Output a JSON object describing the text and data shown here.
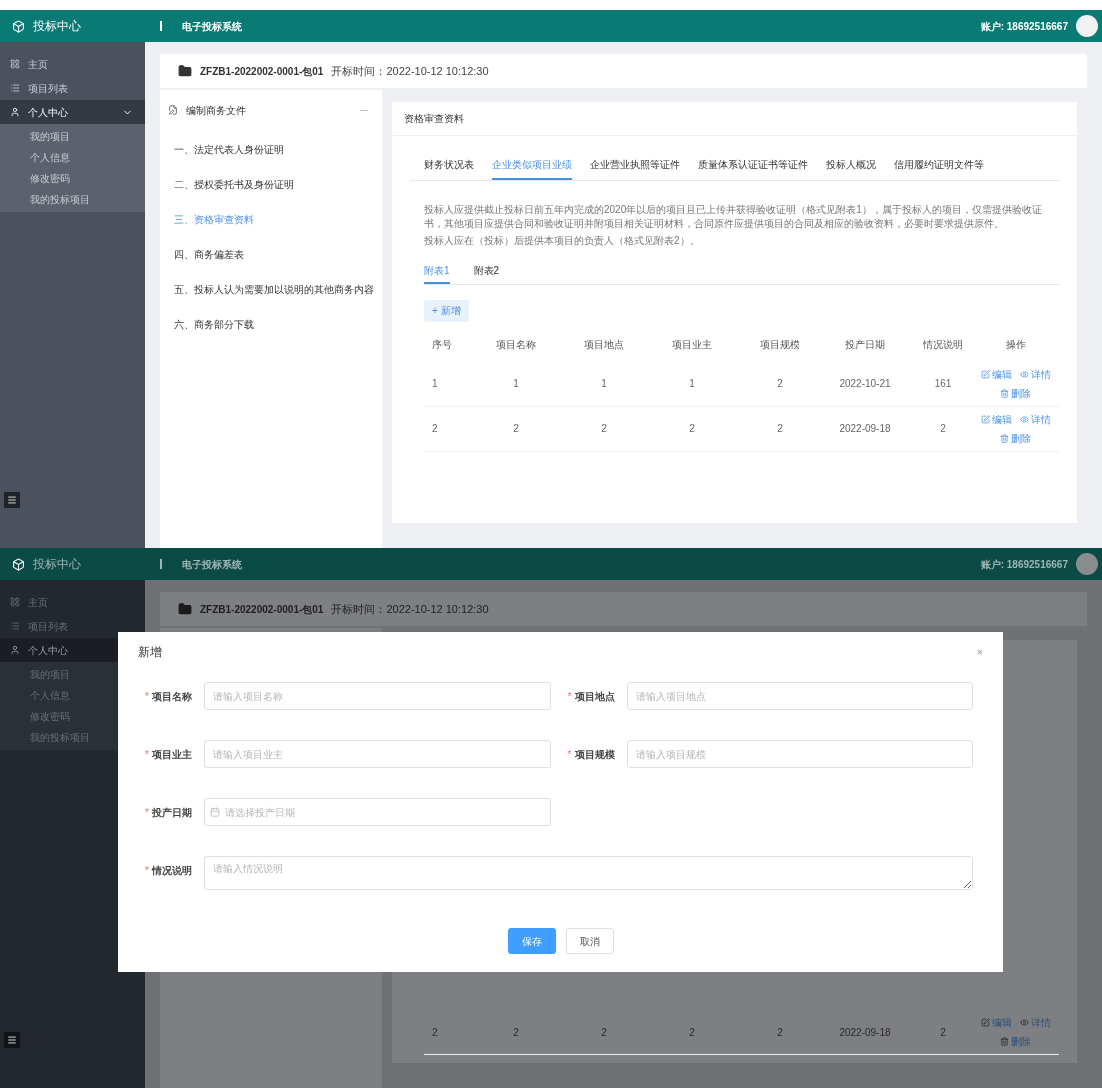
{
  "main_view": {
    "header": {
      "logo": "投标中心",
      "breadcrumb": "电子投标系统",
      "user": "账户: 18692516667"
    },
    "sidebar": {
      "items": [
        {
          "label": "主页",
          "expanded": false
        },
        {
          "label": "项目列表",
          "expanded": false
        },
        {
          "label": "个人中心",
          "expanded": true,
          "children": [
            {
              "label": "我的项目"
            },
            {
              "label": "个人信息"
            },
            {
              "label": "修改密码"
            },
            {
              "label": "我的投标项目"
            }
          ]
        }
      ]
    },
    "doc_header": {
      "code": "ZFZB1-2022002-0001-包01",
      "time": "开标时间：2022-10-12 10:12:30"
    },
    "outline": {
      "title": "编制商务文件",
      "expanded": true,
      "items": [
        {
          "label": "一、法定代表人身份证明",
          "selected": false
        },
        {
          "label": "二、授权委托书及身份证明",
          "selected": false
        },
        {
          "label": "三、资格审查资料",
          "selected": true
        },
        {
          "label": "四、商务偏差表",
          "selected": false
        },
        {
          "label": "五、投标人认为需要加以说明的其他商务内容",
          "selected": false
        },
        {
          "label": "六、商务部分下载",
          "selected": false
        }
      ]
    },
    "card": {
      "title": "资格审查资料",
      "tabs": [
        {
          "label": "财务状况表",
          "selected": false
        },
        {
          "label": "企业类似项目业绩",
          "selected": true
        },
        {
          "label": "企业营业执照等证件",
          "selected": false
        },
        {
          "label": "质量体系认证证书等证件",
          "selected": false
        },
        {
          "label": "投标人概况",
          "selected": false
        },
        {
          "label": "信用履约证明文件等",
          "selected": false
        }
      ],
      "notes": [
        "投标人应提供截止投标日前五年内完成的2020年以后的项目且已上传并获得验收证明（格式见附表1），属于投标人的项目，仅需提供验收证书，其他项目应提供合同和验收证明并附项目相关证明材料，合同原件应提供项目的合同及相应的验收资料，必要时要求提供原件。",
        "投标人应在（投标）后提供本项目的负责人（格式见附表2）。"
      ],
      "subtabs": [
        {
          "label": "附表1",
          "selected": true
        },
        {
          "label": "附表2",
          "selected": false
        }
      ],
      "add_button": "+ 新增",
      "table": {
        "columns": [
          "序号",
          "项目名称",
          "项目地点",
          "项目业主",
          "项目规模",
          "投产日期",
          "情况说明",
          "操作"
        ],
        "rows": [
          {
            "cells": [
              "1",
              "1",
              "1",
              "1",
              "2",
              "2022-10-21",
              "161"
            ],
            "actions": [
              "编辑",
              "详情",
              "删除"
            ]
          },
          {
            "cells": [
              "2",
              "2",
              "2",
              "2",
              "2",
              "2022-09-18",
              "2"
            ],
            "actions": [
              "编辑",
              "详情",
              "删除"
            ]
          }
        ]
      }
    }
  },
  "dialog_view": {
    "header": {
      "logo": "投标中心",
      "breadcrumb": "电子投标系统",
      "user": "账户: 18692516667"
    },
    "sidebar": {
      "items": [
        {
          "label": "主页",
          "expanded": false
        },
        {
          "label": "项目列表",
          "expanded": false
        },
        {
          "label": "个人中心",
          "expanded": true,
          "children": [
            {
              "label": "我的项目"
            },
            {
              "label": "个人信息"
            },
            {
              "label": "修改密码"
            },
            {
              "label": "我的投标项目"
            }
          ]
        }
      ]
    },
    "doc_header": {
      "code": "ZFZB1-2022002-0001-包01",
      "time": "开标时间：2022-10-12 10:12:30"
    },
    "table_row": {
      "cells": [
        "2",
        "2",
        "2",
        "2",
        "2",
        "2022-09-18",
        "2"
      ],
      "actions": [
        "编辑",
        "详情",
        "删除"
      ]
    },
    "dialog": {
      "title": "新增",
      "close": "×",
      "fields": [
        {
          "label": "项目名称",
          "required_mark": "*",
          "placeholder": "请输入项目名称",
          "kind": "text"
        },
        {
          "label": "项目地点",
          "required_mark": "*",
          "placeholder": "请输入项目地点",
          "kind": "text"
        },
        {
          "label": "项目业主",
          "required_mark": "*",
          "placeholder": "请输入项目业主",
          "kind": "text"
        },
        {
          "label": "项目规模",
          "required_mark": "*",
          "placeholder": "请输入项目规模",
          "kind": "text"
        },
        {
          "label": "投产日期",
          "required_mark": "*",
          "placeholder": "请选择投产日期",
          "kind": "date"
        },
        {
          "label": "情况说明",
          "required_mark": "*",
          "placeholder": "请输入情况说明",
          "kind": "textarea"
        }
      ],
      "buttons": [
        {
          "label": "保存",
          "kind": "primary"
        },
        {
          "label": "取消",
          "kind": "plain"
        }
      ]
    }
  }
}
